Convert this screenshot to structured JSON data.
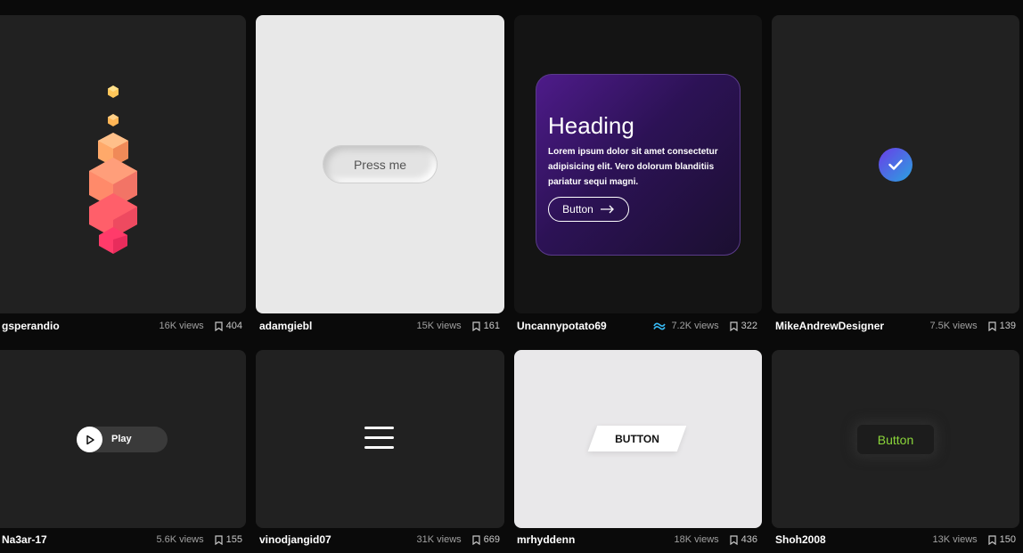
{
  "cards": [
    {
      "author": "gsperandio",
      "views": "16K views",
      "saves": "404"
    },
    {
      "author": "adamgiebl",
      "views": "15K views",
      "saves": "161",
      "button_label": "Press me"
    },
    {
      "author": "Uncannypotato69",
      "views": "7.2K views",
      "saves": "322",
      "heading": "Heading",
      "body": "Lorem ipsum dolor sit amet consectetur adipisicing elit. Vero dolorum blanditiis pariatur sequi magni.",
      "button_label": "Button",
      "framework_icon": "tailwind-icon"
    },
    {
      "author": "MikeAndrewDesigner",
      "views": "7.5K views",
      "saves": "139",
      "icon": "check-icon"
    },
    {
      "author": "Na3ar-17",
      "views": "5.6K views",
      "saves": "155",
      "button_label": "Play"
    },
    {
      "author": "vinodjangid07",
      "views": "31K views",
      "saves": "669",
      "icon": "hamburger-menu-icon"
    },
    {
      "author": "mrhyddenn",
      "views": "18K views",
      "saves": "436",
      "button_label": "BUTTON"
    },
    {
      "author": "Shoh2008",
      "views": "13K views",
      "saves": "150",
      "button_label": "Button"
    }
  ],
  "colors": {
    "page_bg": "#0a0a0a",
    "card_dark": "#212121",
    "neon_green": "#8bd63a",
    "purple": "#4e1b8a"
  }
}
